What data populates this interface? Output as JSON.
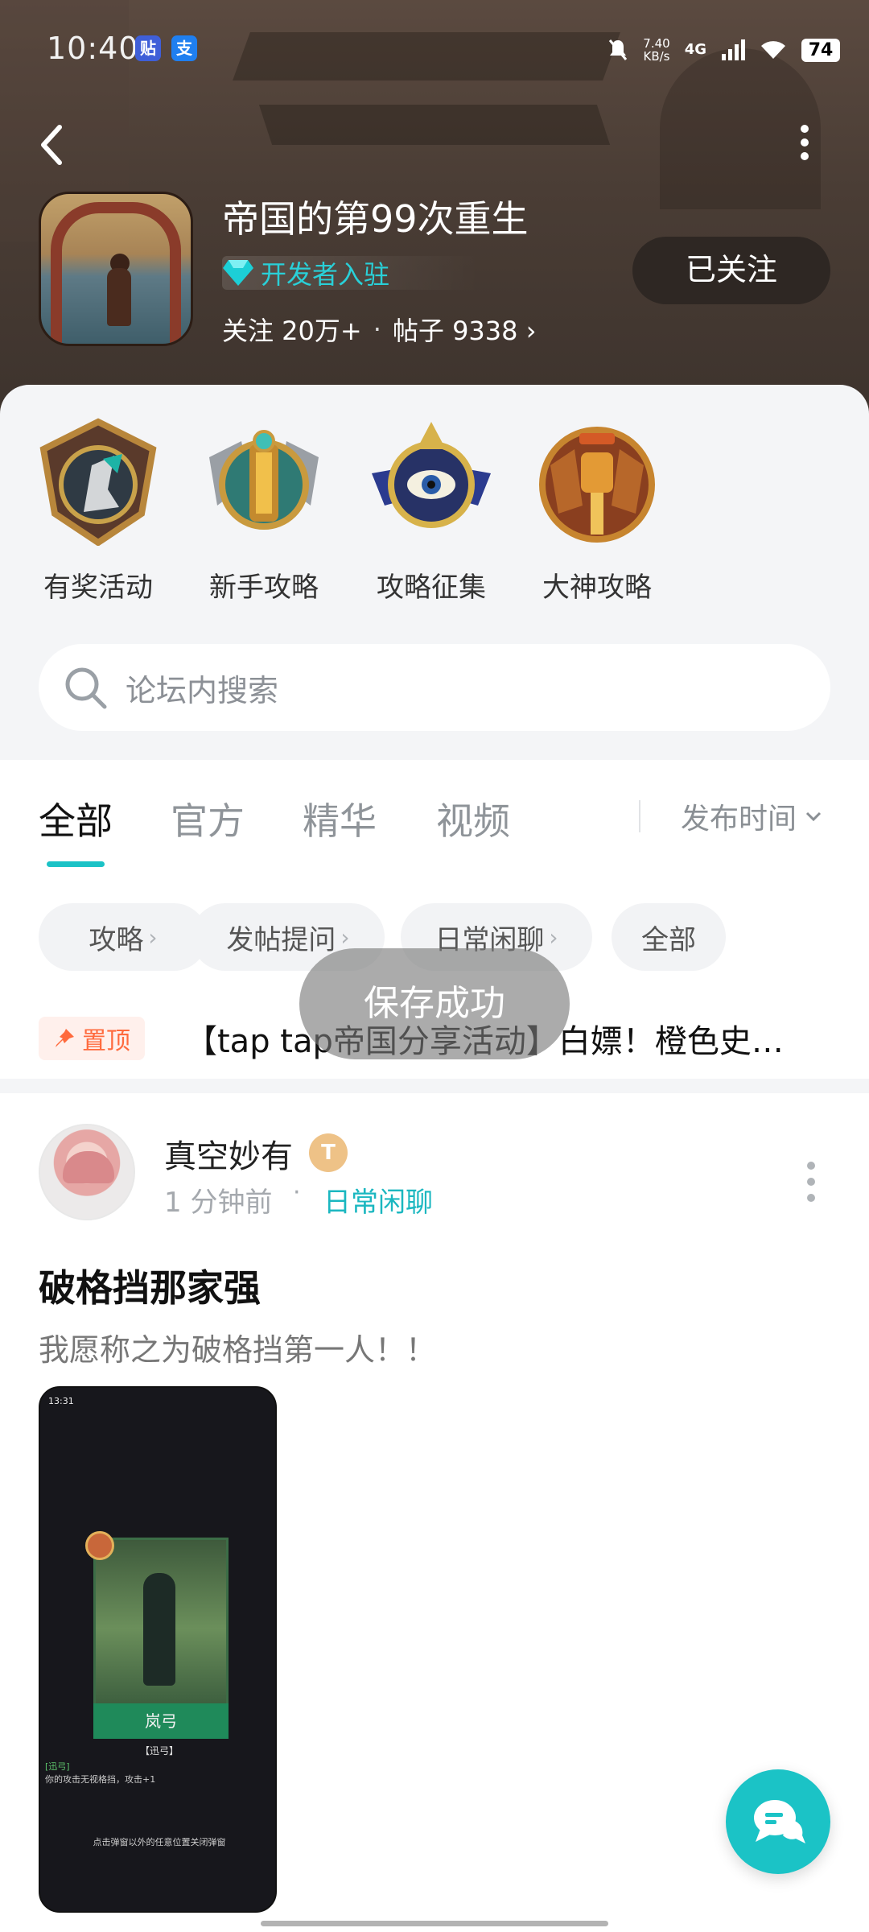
{
  "status_bar": {
    "time": "10:40",
    "app_badge_1": "贴",
    "app_badge_2": "支",
    "net_speed_value": "7.40",
    "net_speed_unit": "KB/s",
    "network": "4G",
    "battery": "74"
  },
  "header": {
    "game_title": "帝国的第99次重生",
    "developer_badge": "开发者入驻",
    "followers_label": "关注 20万+",
    "posts_label": "帖子 9338",
    "follow_button": "已关注"
  },
  "quick_links": [
    {
      "label": "有奖活动",
      "icon": "reward-shield-icon"
    },
    {
      "label": "新手攻略",
      "icon": "beginner-guide-emblem-icon"
    },
    {
      "label": "攻略征集",
      "icon": "guide-collection-emblem-icon"
    },
    {
      "label": "大神攻略",
      "icon": "expert-guide-emblem-icon"
    }
  ],
  "search": {
    "placeholder": "论坛内搜索"
  },
  "tabs": {
    "items": [
      "全部",
      "官方",
      "精华",
      "视频"
    ],
    "active": "全部",
    "sort_label": "发布时间"
  },
  "chips": [
    "攻略",
    "发帖提问",
    "日常闲聊",
    "全部"
  ],
  "pinned": {
    "badge": "置顶",
    "text": "【tap tap帝国分享活动】白嫖！橙色史诗卡牌"
  },
  "post": {
    "author": "真空妙有",
    "level_badge": "T",
    "time": "1 分钟前",
    "separator": "·",
    "category": "日常闲聊",
    "title": "破格挡那家强",
    "excerpt": "我愿称之为破格挡第一人！！",
    "image": {
      "status_time": "13:31",
      "card_name": "岚弓",
      "section_title": "【迅弓】",
      "desc_tag": "[迅弓]",
      "desc_text": "你的攻击无视格挡，攻击+1",
      "hint": "点击弹窗以外的任意位置关闭弹窗"
    }
  },
  "toast": "保存成功",
  "colors": {
    "accent": "#1bc3c6",
    "pin": "#ff6a3d",
    "follow_button_bg": "#2e2723"
  }
}
